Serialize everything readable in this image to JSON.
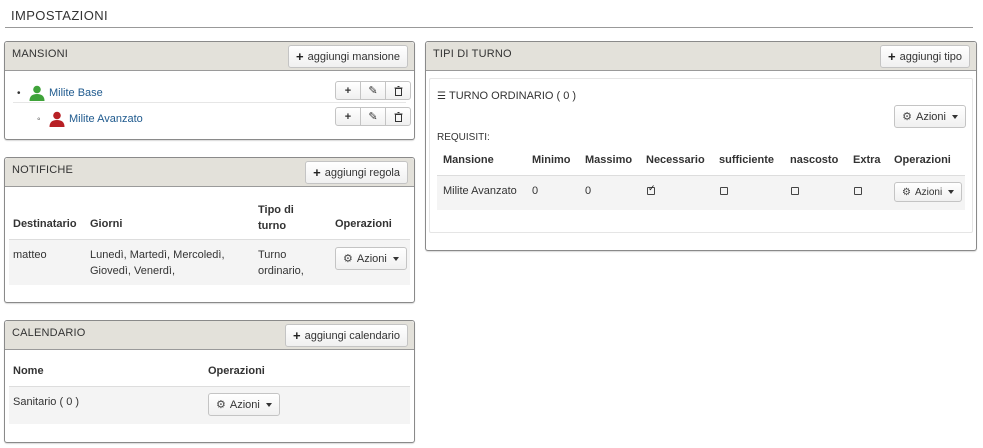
{
  "page": {
    "title": "IMPOSTAZIONI"
  },
  "mansioni": {
    "title": "MANSIONI",
    "add_label": "aggiungi mansione",
    "items": [
      {
        "label": "Milite Base",
        "color": "#3fa33a"
      },
      {
        "label": "Milite Avanzato",
        "color": "#b82025"
      }
    ]
  },
  "notifiche": {
    "title": "NOTIFICHE",
    "add_label": "aggiungi regola",
    "headers": [
      "Destinatario",
      "Giorni",
      "Tipo di turno",
      "Operazioni"
    ],
    "rows": [
      {
        "destinatario": "matteo",
        "giorni": "Lunedì, Martedì, Mercoledì, Giovedì, Venerdì,",
        "tipo": "Turno ordinario,",
        "azioni": "Azioni"
      }
    ]
  },
  "calendario": {
    "title": "CALENDARIO",
    "add_label": "aggiungi calendario",
    "headers": [
      "Nome",
      "Operazioni"
    ],
    "rows": [
      {
        "nome": "Sanitario ( 0 )",
        "azioni": "Azioni"
      }
    ]
  },
  "tipi": {
    "title": "TIPI DI TURNO",
    "add_label": "aggiungi tipo",
    "turno": {
      "title": "TURNO ORDINARIO ( 0 )",
      "azioni": "Azioni",
      "requisiti_label": "REQUISITI:",
      "headers": [
        "Mansione",
        "Minimo",
        "Massimo",
        "Necessario",
        "sufficiente",
        "nascosto",
        "Extra",
        "Operazioni"
      ],
      "rows": [
        {
          "mansione": "Milite Avanzato",
          "minimo": "0",
          "massimo": "0",
          "necessario": true,
          "sufficiente": false,
          "nascosto": false,
          "extra": false,
          "azioni": "Azioni"
        }
      ]
    }
  },
  "icons": {
    "plus": "plus-icon",
    "edit": "edit-icon",
    "trash": "trash-icon",
    "gear": "gear-icon",
    "list": "list-icon",
    "person": "user-icon"
  }
}
